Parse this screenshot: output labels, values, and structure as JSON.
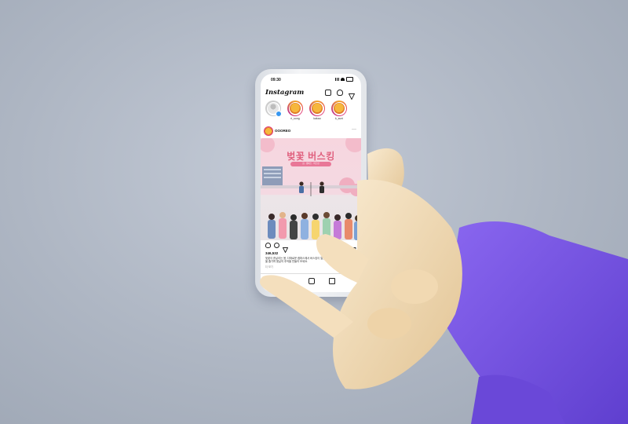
{
  "status": {
    "time": "09:30"
  },
  "app": {
    "name": "Instagram",
    "icons": [
      "add-icon",
      "heart-icon",
      "send-icon"
    ]
  },
  "stories": [
    {
      "label": "",
      "icon": "profile-add-icon"
    },
    {
      "label": "ri_song",
      "icon": "avatar"
    },
    {
      "label": "kakao",
      "icon": "avatar"
    },
    {
      "label": "k_suni",
      "icon": "avatar"
    }
  ],
  "post": {
    "user": "OOOREO",
    "title": "벚꽃 버스킹",
    "subtitle": "봄 · 캠퍼스 · 버스킹",
    "likes": "346,532",
    "caption": "벚꽃이 흩날리는 봄, 다채로운 캠퍼스에서 버스킹이 열렸습니다. 친구들과 함께 음악을 즐기며 봄날의 추억을 만들어 보세요.",
    "more": "더 보기"
  },
  "tabs": [
    "home-icon",
    "search-icon",
    "reels-icon",
    "shop-icon"
  ],
  "colors": {
    "accent": "#e0607e",
    "arm": "#7b55e8",
    "skin": "#f2dcb6"
  }
}
